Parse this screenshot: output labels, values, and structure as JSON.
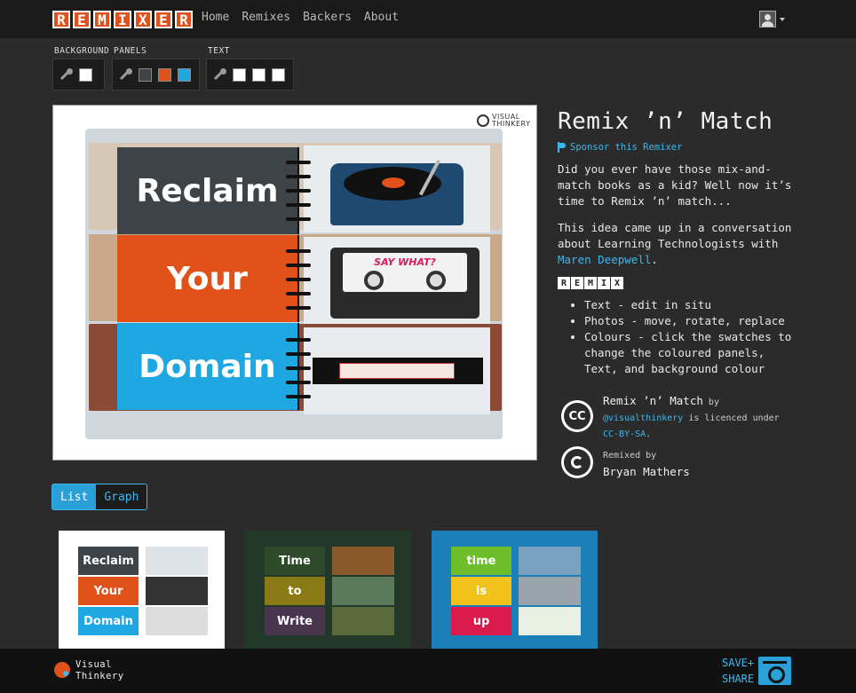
{
  "nav": {
    "logo_letters": [
      "R",
      "E",
      "M",
      "I",
      "X",
      "E",
      "R"
    ],
    "links": [
      "Home",
      "Remixes",
      "Backers",
      "About"
    ]
  },
  "toolbar": {
    "background": {
      "label": "BACKGROUND",
      "swatches": [
        "#ffffff"
      ]
    },
    "panels": {
      "label": "PANELS",
      "swatches": [
        "#3d4347",
        "#e0521a",
        "#1ea7e1"
      ]
    },
    "text": {
      "label": "TEXT",
      "swatches": [
        "#ffffff",
        "#ffffff",
        "#ffffff"
      ]
    }
  },
  "hero": {
    "brand_mark": "VISUAL THINKERY",
    "panels": [
      "Reclaim",
      "Your",
      "Domain"
    ],
    "cassette_label": "SAY WHAT?"
  },
  "info": {
    "title": "Remix ’n’ Match",
    "sponsor": "Sponsor this Remixer",
    "para1": "Did you ever have those mix-and-match books as a kid? Well now it’s time to Remix ’n’ match...",
    "para2_text": "This idea came up in a conversation about Learning Technologists with",
    "para2_link": "Maren Deepwell",
    "para2_end": ".",
    "badge_letters": [
      "R",
      "E",
      "M",
      "I",
      "X"
    ],
    "bullets": [
      "Text - edit in situ",
      "Photos - move, rotate, replace",
      "Colours - click the swatches to change the coloured panels, Text, and background colour"
    ]
  },
  "license": {
    "work_title": "Remix ’n’ Match",
    "by": "by",
    "author": "@visualthinkery",
    "is_licenced": "is licenced under",
    "licence": "CC-BY-SA",
    "period": ".",
    "cc_icon": "CC",
    "remixed_label": "Remixed by",
    "remixer": "Bryan Mathers"
  },
  "tabs": [
    "List",
    "Graph"
  ],
  "thumbnails": [
    {
      "words": [
        "Reclaim",
        "Your",
        "Domain"
      ],
      "colors": [
        "#3d4347",
        "#e0521a",
        "#1ea7e1"
      ],
      "bg": "#ffffff"
    },
    {
      "words": [
        "Time",
        "to",
        "Write"
      ],
      "colors": [
        "#2f4a2a",
        "#8a7a16",
        "#4a3550"
      ],
      "bg": "#223828"
    },
    {
      "words": [
        "time",
        "is",
        "up"
      ],
      "colors": [
        "#6cbf2a",
        "#f1c21b",
        "#d81b4a"
      ],
      "bg": "#1b7fb8"
    }
  ],
  "footer": {
    "brand_line1": "Visual",
    "brand_line2": "Thinkery",
    "save": "SAVE+",
    "share": "SHARE"
  }
}
